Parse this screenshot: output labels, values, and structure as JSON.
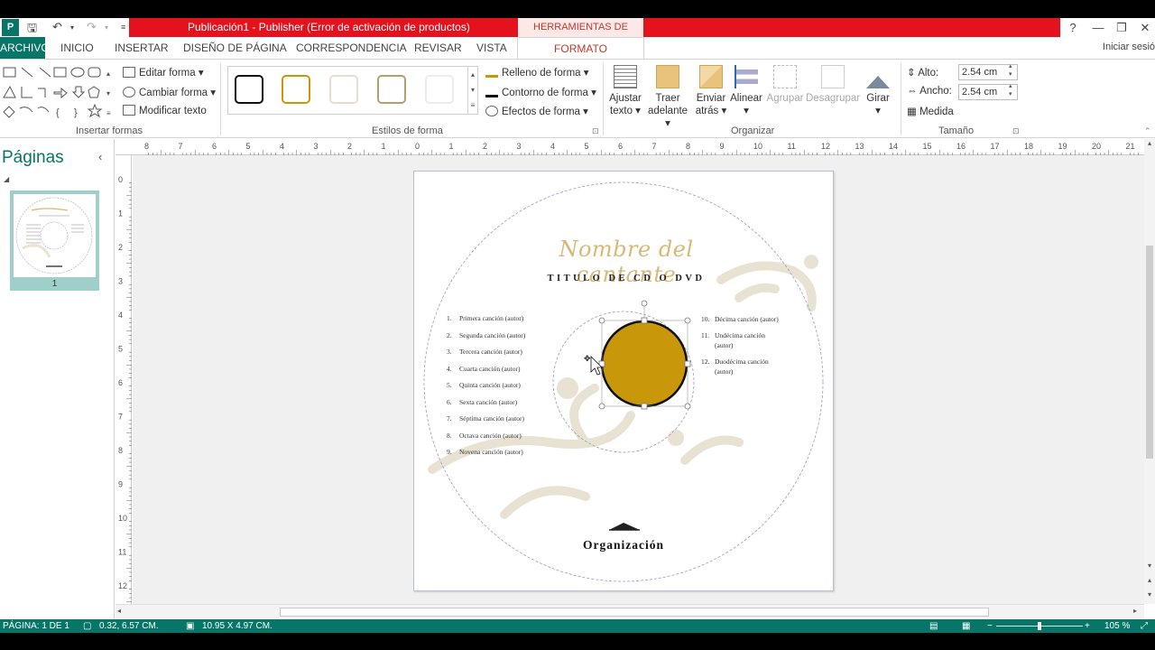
{
  "titlebar": {
    "title": "Publicación1 -  Publisher (Error de activación de productos)",
    "tools_tab": "HERRAMIENTAS DE DIBUJO",
    "help": "?",
    "minimize": "—",
    "restore": "❐",
    "close": "✕"
  },
  "tabs": {
    "file": "ARCHIVO",
    "items": [
      "INICIO",
      "INSERTAR",
      "DISEÑO DE PÁGINA",
      "CORRESPONDENCIA",
      "REVISAR",
      "VISTA"
    ],
    "active": "FORMATO",
    "signin": "Iniciar sesió"
  },
  "ribbon": {
    "insert_shapes": {
      "label": "Insertar formas",
      "edit_shape": "Editar forma",
      "change_shape": "Cambiar forma",
      "edit_text": "Modificar texto"
    },
    "shape_styles": {
      "label": "Estilos de forma",
      "fill": "Relleno de forma",
      "outline": "Contorno de forma",
      "effects": "Efectos de forma"
    },
    "arrange": {
      "label": "Organizar",
      "wrap_text": [
        "Ajustar",
        "texto"
      ],
      "bring_forward": [
        "Traer",
        "adelante"
      ],
      "send_backward": [
        "Enviar",
        "atrás"
      ],
      "align": [
        "Alinear",
        ""
      ],
      "group": "Agrupar",
      "ungroup": "Desagrupar",
      "rotate": "Girar"
    },
    "size": {
      "label": "Tamaño",
      "height_label": "Alto:",
      "height_value": "2.54 cm",
      "width_label": "Ancho:",
      "width_value": "2.54 cm",
      "measure": "Medida"
    }
  },
  "pages_pane": {
    "title": "Páginas",
    "page_number": "1"
  },
  "ruler": {
    "h_numbers": [
      "8",
      "7",
      "6",
      "5",
      "4",
      "3",
      "2",
      "1",
      "0",
      "1",
      "2",
      "3",
      "4",
      "5",
      "6",
      "7",
      "8",
      "9",
      "10",
      "11",
      "12",
      "13",
      "14",
      "15",
      "16",
      "17",
      "18",
      "19",
      "20",
      "21"
    ],
    "v_numbers": [
      "0",
      "1",
      "2",
      "3",
      "4",
      "5",
      "6",
      "7",
      "8",
      "9",
      "10",
      "11",
      "12"
    ]
  },
  "document": {
    "artist": "Nombre del cantante",
    "cd_title": "TITULO DE CD O DVD",
    "songs_left": [
      {
        "num": "1.",
        "text": "Primera canción (autor)"
      },
      {
        "num": "2.",
        "text": "Segunda canción (autor)"
      },
      {
        "num": "3.",
        "text": "Tercera canción (autor)"
      },
      {
        "num": "4.",
        "text": "Cuarta canción (autor)"
      },
      {
        "num": "5.",
        "text": "Quinta canción (autor)"
      },
      {
        "num": "6.",
        "text": "Sexta canción (autor)"
      },
      {
        "num": "7.",
        "text": "Séptima canción (autor)"
      },
      {
        "num": "8.",
        "text": "Octava canción (autor)"
      },
      {
        "num": "9.",
        "text": "Novena canción (autor)"
      }
    ],
    "songs_right": [
      {
        "num": "10.",
        "line1": "Décima canción (autor)",
        "line2": ""
      },
      {
        "num": "11.",
        "line1": "Undécima canción",
        "line2": "(autor)"
      },
      {
        "num": "12.",
        "line1": "Duodécima canción",
        "line2": "(autor)"
      }
    ],
    "organization": "Organización",
    "circle_fill": "#c9980a"
  },
  "status": {
    "page": "PÁGINA: 1 DE 1",
    "position": "0.32, 6.57 CM.",
    "size": "10.95 X  4.97 CM.",
    "zoom": "105 %"
  },
  "colors": {
    "accent": "#077568",
    "title_red": "#e3121d",
    "gold": "#c9980a"
  }
}
